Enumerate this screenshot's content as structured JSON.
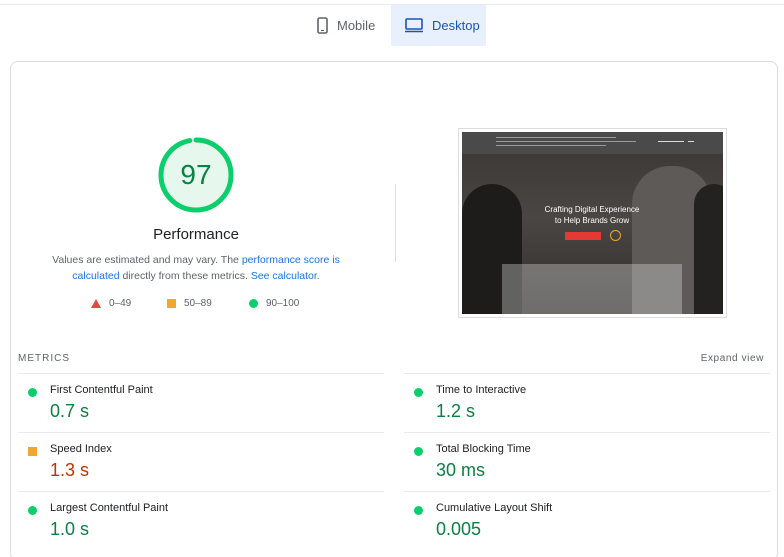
{
  "tabs": [
    {
      "label": "Mobile",
      "icon": "phone-icon",
      "active": false
    },
    {
      "label": "Desktop",
      "icon": "desktop-icon",
      "active": true
    }
  ],
  "performance": {
    "score": "97",
    "score_fraction": 0.97,
    "title": "Performance",
    "description_1": "Values are estimated and may vary. The ",
    "link_score": "performance score is calculated",
    "description_2": " directly from these metrics. ",
    "link_calculator": "See calculator",
    "description_3": ".",
    "score_color": "#0cce6b",
    "score_text_color": "#0b8043"
  },
  "legend": [
    {
      "range": "0–49",
      "shape": "triangle",
      "color": "#e8453c"
    },
    {
      "range": "50–89",
      "shape": "square",
      "color": "#f4a52b"
    },
    {
      "range": "90–100",
      "shape": "circle",
      "color": "#0cce6b"
    }
  ],
  "screenshot": {
    "headline_1": "Crafting Digital Experience",
    "headline_2": "to Help Brands Grow"
  },
  "metrics_section": {
    "label": "METRICS",
    "expand": "Expand view"
  },
  "metrics": [
    {
      "name": "First Contentful Paint",
      "value": "0.7 s",
      "status": "good"
    },
    {
      "name": "Time to Interactive",
      "value": "1.2 s",
      "status": "good"
    },
    {
      "name": "Speed Index",
      "value": "1.3 s",
      "status": "average"
    },
    {
      "name": "Total Blocking Time",
      "value": "30 ms",
      "status": "good"
    },
    {
      "name": "Largest Contentful Paint",
      "value": "1.0 s",
      "status": "good"
    },
    {
      "name": "Cumulative Layout Shift",
      "value": "0.005",
      "status": "good"
    }
  ]
}
